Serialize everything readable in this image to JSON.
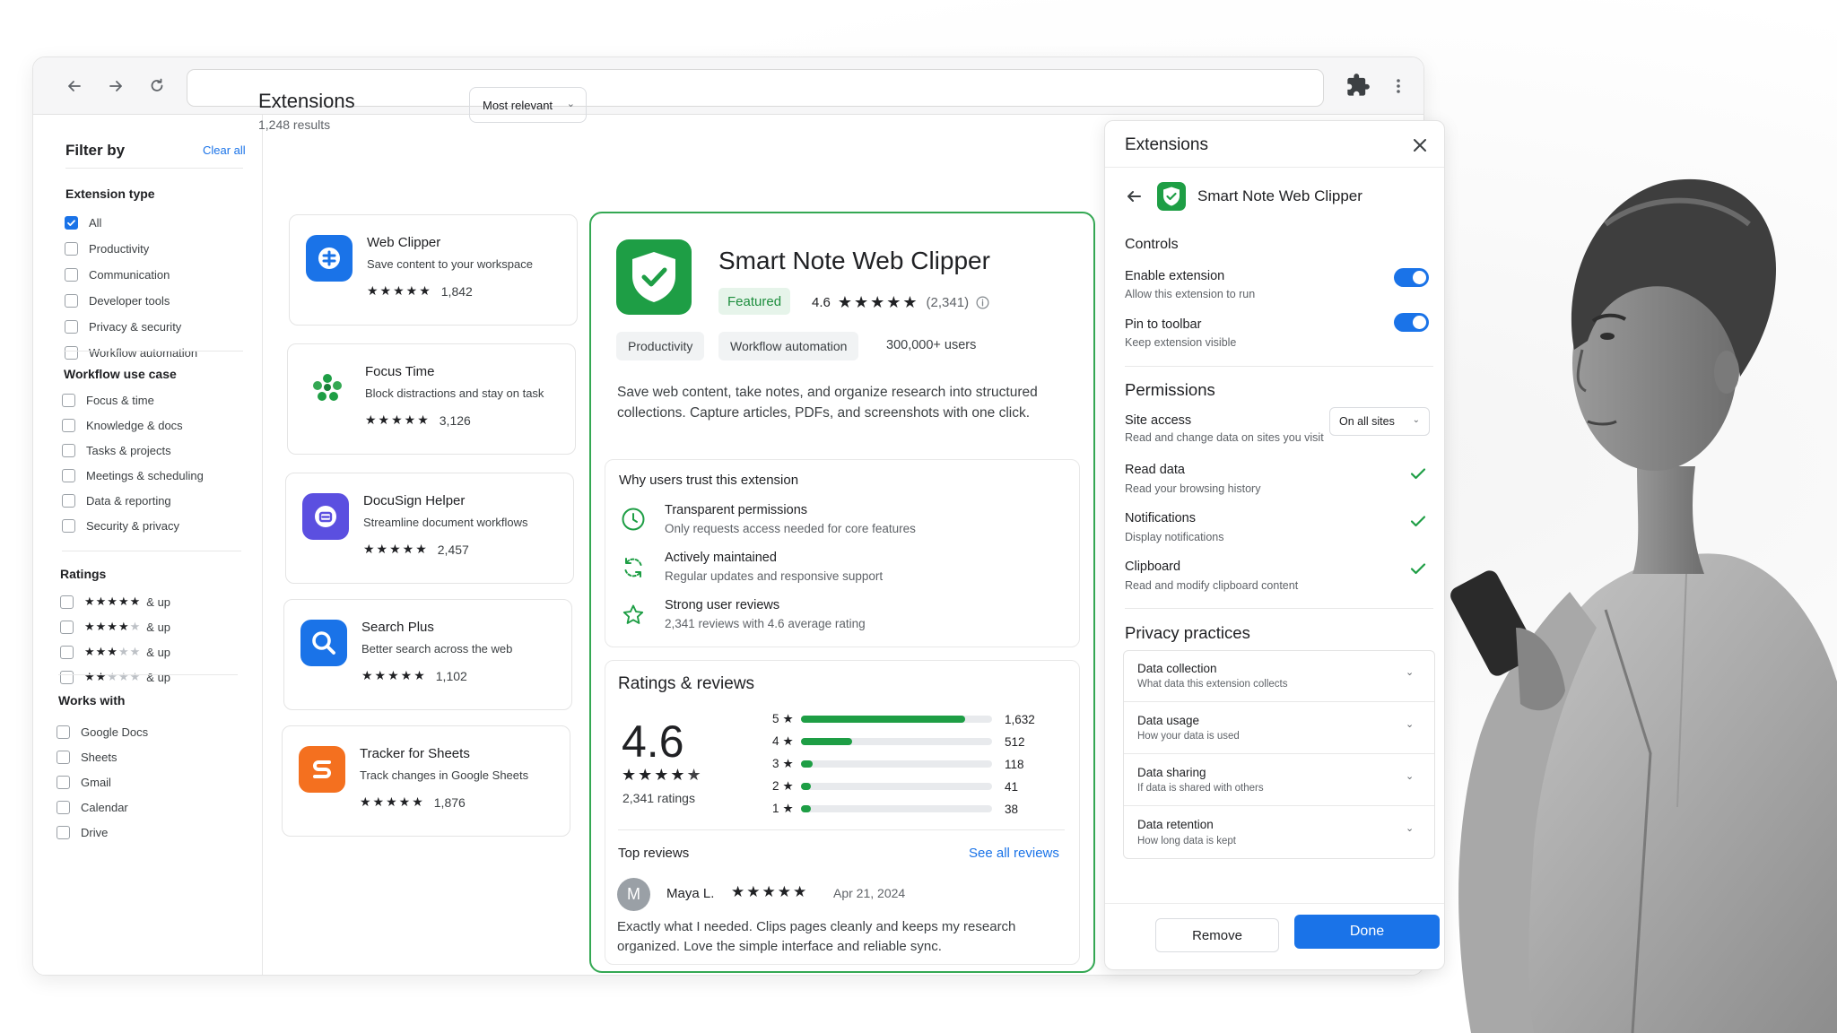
{
  "filters": {
    "title": "Filter by",
    "clear_label": "Clear all",
    "extension_type": {
      "title": "Extension type",
      "items": [
        {
          "label": "All",
          "checked": true
        },
        {
          "label": "Productivity",
          "checked": false
        },
        {
          "label": "Communication",
          "checked": false
        },
        {
          "label": "Developer tools",
          "checked": false
        },
        {
          "label": "Privacy & security",
          "checked": false
        },
        {
          "label": "Workflow automation",
          "checked": false
        }
      ]
    },
    "workflow": {
      "title": "Workflow use case",
      "items": [
        {
          "label": "Focus & time"
        },
        {
          "label": "Knowledge & docs"
        },
        {
          "label": "Tasks & projects"
        },
        {
          "label": "Meetings & scheduling"
        },
        {
          "label": "Data & reporting"
        },
        {
          "label": "Security & privacy"
        }
      ]
    },
    "ratings": {
      "title": "Ratings",
      "items": [
        {
          "stars": 5,
          "label": "& up"
        },
        {
          "stars": 4,
          "label": "& up"
        },
        {
          "stars": 3,
          "label": "& up"
        },
        {
          "stars": 2,
          "label": "& up"
        }
      ]
    },
    "works_with": {
      "title": "Works with",
      "items": [
        {
          "label": "Google Docs"
        },
        {
          "label": "Sheets"
        },
        {
          "label": "Gmail"
        },
        {
          "label": "Calendar"
        },
        {
          "label": "Drive"
        }
      ]
    }
  },
  "content": {
    "title": "Extensions",
    "results": "1,248 results",
    "sort_label": "Most relevant"
  },
  "extensions": [
    {
      "name": "Web Clipper",
      "desc": "Save content to your workspace",
      "rating": 4.5,
      "count": "1,842",
      "color": "#1a73e8",
      "icon": "clipper-icon"
    },
    {
      "name": "Focus Time",
      "desc": "Block distractions and stay on task",
      "rating": 4.5,
      "count": "3,126",
      "color": "#ffffff",
      "icon": "focus-icon"
    },
    {
      "name": "DocuSign Helper",
      "desc": "Streamline document workflows",
      "rating": 4.5,
      "count": "2,457",
      "color": "#5b4fe0",
      "icon": "docusign-icon"
    },
    {
      "name": "Search Plus",
      "desc": "Better search across the web",
      "rating": 4.5,
      "count": "1,102",
      "color": "#1a73e8",
      "icon": "search-icon"
    },
    {
      "name": "Tracker for Sheets",
      "desc": "Track changes in Google Sheets",
      "rating": 4.5,
      "count": "1,876",
      "color": "#f4701f",
      "icon": "sheets-tracker-icon"
    }
  ],
  "detail": {
    "name": "Smart Note Web Clipper",
    "badge": "Featured",
    "rating": "4.6",
    "rating_count": "(2,341)",
    "chips": [
      "Productivity",
      "Workflow automation"
    ],
    "users": "300,000+ users",
    "description": "Save web content, take notes, and organize research into structured collections. Capture articles, PDFs, and screenshots with one click.",
    "trust": {
      "title": "Why users trust this extension",
      "items": [
        {
          "title": "Transparent permissions",
          "sub": "Only requests access needed for core features",
          "icon": "clock-icon"
        },
        {
          "title": "Actively maintained",
          "sub": "Regular updates and responsive support",
          "icon": "refresh-icon"
        },
        {
          "title": "Strong user reviews",
          "sub": "2,341 reviews with 4.6 average rating",
          "icon": "star-icon"
        }
      ]
    },
    "reviews": {
      "title": "Ratings & reviews",
      "average": "4.6",
      "ratings_label": "2,341 ratings",
      "histogram": [
        {
          "stars": "5",
          "count": "1,632",
          "value": 1632
        },
        {
          "stars": "4",
          "count": "512",
          "value": 512
        },
        {
          "stars": "3",
          "count": "118",
          "value": 118
        },
        {
          "stars": "2",
          "count": "41",
          "value": 41
        },
        {
          "stars": "1",
          "count": "38",
          "value": 38
        }
      ],
      "top_title": "Top reviews",
      "see_all": "See all reviews",
      "review": {
        "initial": "M",
        "name": "Maya L.",
        "date": "Apr 21, 2024",
        "text": "Exactly what I needed. Clips pages cleanly and keeps my research organized. Love the simple interface and reliable sync."
      }
    }
  },
  "panel": {
    "title": "Extensions",
    "ext_name": "Smart Note Web Clipper",
    "controls_title": "Controls",
    "controls": [
      {
        "title": "Enable extension",
        "sub": "Allow this extension to run",
        "on": true
      },
      {
        "title": "Pin to toolbar",
        "sub": "Keep extension visible",
        "on": true
      }
    ],
    "permissions_title": "Permissions",
    "site_access": {
      "title": "Site access",
      "sub": "Read and change data on sites you visit",
      "value": "On all sites"
    },
    "permissions": [
      {
        "title": "Read data",
        "sub": "Read your browsing history"
      },
      {
        "title": "Notifications",
        "sub": "Display notifications"
      },
      {
        "title": "Clipboard",
        "sub": "Read and modify clipboard content"
      }
    ],
    "privacy_title": "Privacy practices",
    "privacy": [
      {
        "title": "Data collection",
        "sub": "What data this extension collects"
      },
      {
        "title": "Data usage",
        "sub": "How your data is used"
      },
      {
        "title": "Data sharing",
        "sub": "If data is shared with others"
      },
      {
        "title": "Data retention",
        "sub": "How long data is kept"
      }
    ],
    "remove_label": "Remove",
    "done_label": "Done"
  },
  "colors": {
    "accent": "#1a73e8",
    "brand_green": "#1e9e45",
    "featured_bg": "#e6f4ea"
  }
}
